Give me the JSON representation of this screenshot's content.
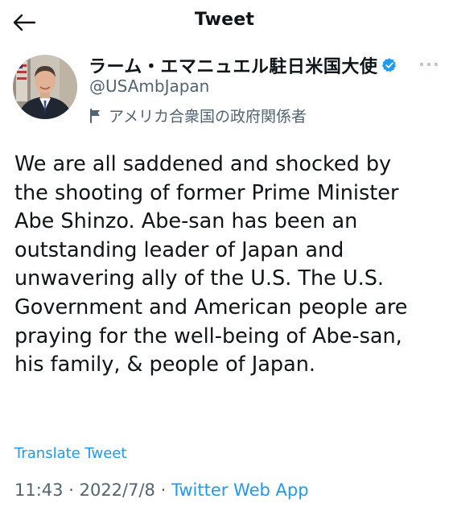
{
  "header": {
    "title": "Tweet"
  },
  "author": {
    "display_name": "ラーム・エマニュエル駐日米国大使",
    "handle": "@USAmbJapan",
    "label": "アメリカ合衆国の政府関係者"
  },
  "tweet": {
    "text": "We are all saddened and shocked by\nthe shooting of former Prime Minister\nAbe Shinzo.  Abe-san has been an\noutstanding leader of Japan and\nunwavering ally of the U.S. The U.S.\nGovernment and American people are\npraying for the well-being of Abe-san,\nhis family, & people of Japan.",
    "translate_label": "Translate Tweet",
    "time": "11:43",
    "date": "2022/7/8",
    "sep": "·",
    "source": "Twitter Web App"
  },
  "colors": {
    "accent": "#1d9bf0",
    "secondary_text": "#536471",
    "primary_text": "#0f1419"
  },
  "icons": {
    "back": "arrow-left",
    "verified": "verified-badge",
    "more": "more-horizontal",
    "label": "flag"
  }
}
